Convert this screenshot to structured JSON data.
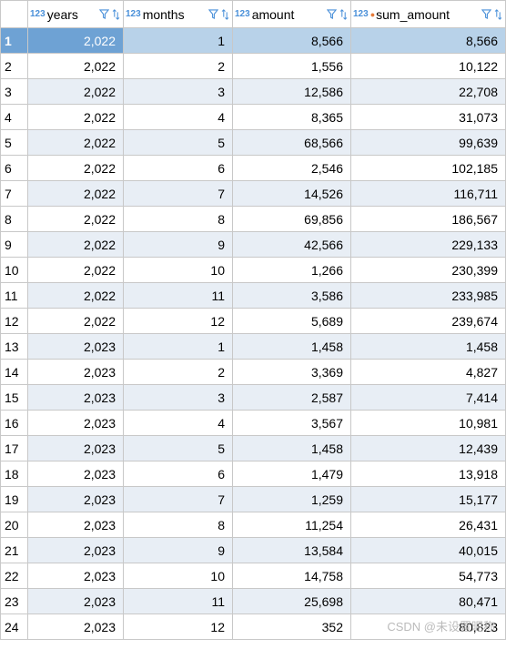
{
  "columns": [
    {
      "name": "years",
      "typeIcon": "123",
      "calcIcon": false
    },
    {
      "name": "months",
      "typeIcon": "123",
      "calcIcon": false
    },
    {
      "name": "amount",
      "typeIcon": "123",
      "calcIcon": false
    },
    {
      "name": "sum_amount",
      "typeIcon": "123",
      "calcIcon": true
    }
  ],
  "rows": [
    {
      "n": "1",
      "years": "2,022",
      "months": "1",
      "amount": "8,566",
      "sum_amount": "8,566",
      "selected": true,
      "active": "years"
    },
    {
      "n": "2",
      "years": "2,022",
      "months": "2",
      "amount": "1,556",
      "sum_amount": "10,122"
    },
    {
      "n": "3",
      "years": "2,022",
      "months": "3",
      "amount": "12,586",
      "sum_amount": "22,708"
    },
    {
      "n": "4",
      "years": "2,022",
      "months": "4",
      "amount": "8,365",
      "sum_amount": "31,073"
    },
    {
      "n": "5",
      "years": "2,022",
      "months": "5",
      "amount": "68,566",
      "sum_amount": "99,639"
    },
    {
      "n": "6",
      "years": "2,022",
      "months": "6",
      "amount": "2,546",
      "sum_amount": "102,185"
    },
    {
      "n": "7",
      "years": "2,022",
      "months": "7",
      "amount": "14,526",
      "sum_amount": "116,711"
    },
    {
      "n": "8",
      "years": "2,022",
      "months": "8",
      "amount": "69,856",
      "sum_amount": "186,567"
    },
    {
      "n": "9",
      "years": "2,022",
      "months": "9",
      "amount": "42,566",
      "sum_amount": "229,133"
    },
    {
      "n": "10",
      "years": "2,022",
      "months": "10",
      "amount": "1,266",
      "sum_amount": "230,399"
    },
    {
      "n": "11",
      "years": "2,022",
      "months": "11",
      "amount": "3,586",
      "sum_amount": "233,985"
    },
    {
      "n": "12",
      "years": "2,022",
      "months": "12",
      "amount": "5,689",
      "sum_amount": "239,674"
    },
    {
      "n": "13",
      "years": "2,023",
      "months": "1",
      "amount": "1,458",
      "sum_amount": "1,458"
    },
    {
      "n": "14",
      "years": "2,023",
      "months": "2",
      "amount": "3,369",
      "sum_amount": "4,827"
    },
    {
      "n": "15",
      "years": "2,023",
      "months": "3",
      "amount": "2,587",
      "sum_amount": "7,414"
    },
    {
      "n": "16",
      "years": "2,023",
      "months": "4",
      "amount": "3,567",
      "sum_amount": "10,981"
    },
    {
      "n": "17",
      "years": "2,023",
      "months": "5",
      "amount": "1,458",
      "sum_amount": "12,439"
    },
    {
      "n": "18",
      "years": "2,023",
      "months": "6",
      "amount": "1,479",
      "sum_amount": "13,918"
    },
    {
      "n": "19",
      "years": "2,023",
      "months": "7",
      "amount": "1,259",
      "sum_amount": "15,177"
    },
    {
      "n": "20",
      "years": "2,023",
      "months": "8",
      "amount": "11,254",
      "sum_amount": "26,431"
    },
    {
      "n": "21",
      "years": "2,023",
      "months": "9",
      "amount": "13,584",
      "sum_amount": "40,015"
    },
    {
      "n": "22",
      "years": "2,023",
      "months": "10",
      "amount": "14,758",
      "sum_amount": "54,773"
    },
    {
      "n": "23",
      "years": "2,023",
      "months": "11",
      "amount": "25,698",
      "sum_amount": "80,471"
    },
    {
      "n": "24",
      "years": "2,023",
      "months": "12",
      "amount": "352",
      "sum_amount": "80,823"
    }
  ],
  "watermark": "CSDN @未设置昵称"
}
